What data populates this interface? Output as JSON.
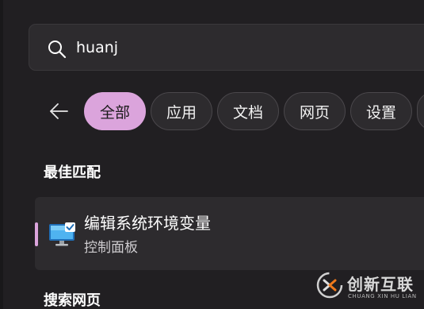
{
  "search": {
    "query": "huanj"
  },
  "filters": {
    "back_icon": "arrow-left-icon",
    "chips": [
      {
        "label": "全部",
        "active": true
      },
      {
        "label": "应用",
        "active": false
      },
      {
        "label": "文档",
        "active": false
      },
      {
        "label": "网页",
        "active": false
      },
      {
        "label": "设置",
        "active": false
      }
    ]
  },
  "best_match": {
    "heading": "最佳匹配",
    "result": {
      "title": "编辑系统环境变量",
      "subtitle": "控制面板",
      "icon": "monitor-settings-icon"
    }
  },
  "web_search": {
    "heading": "搜索网页"
  },
  "watermark": {
    "name": "创新互联",
    "sub": "CHUANG XIN HU LIAN"
  },
  "colors": {
    "accent": "#dba4dc",
    "background": "#211f22",
    "surface": "#2d2b2e"
  }
}
